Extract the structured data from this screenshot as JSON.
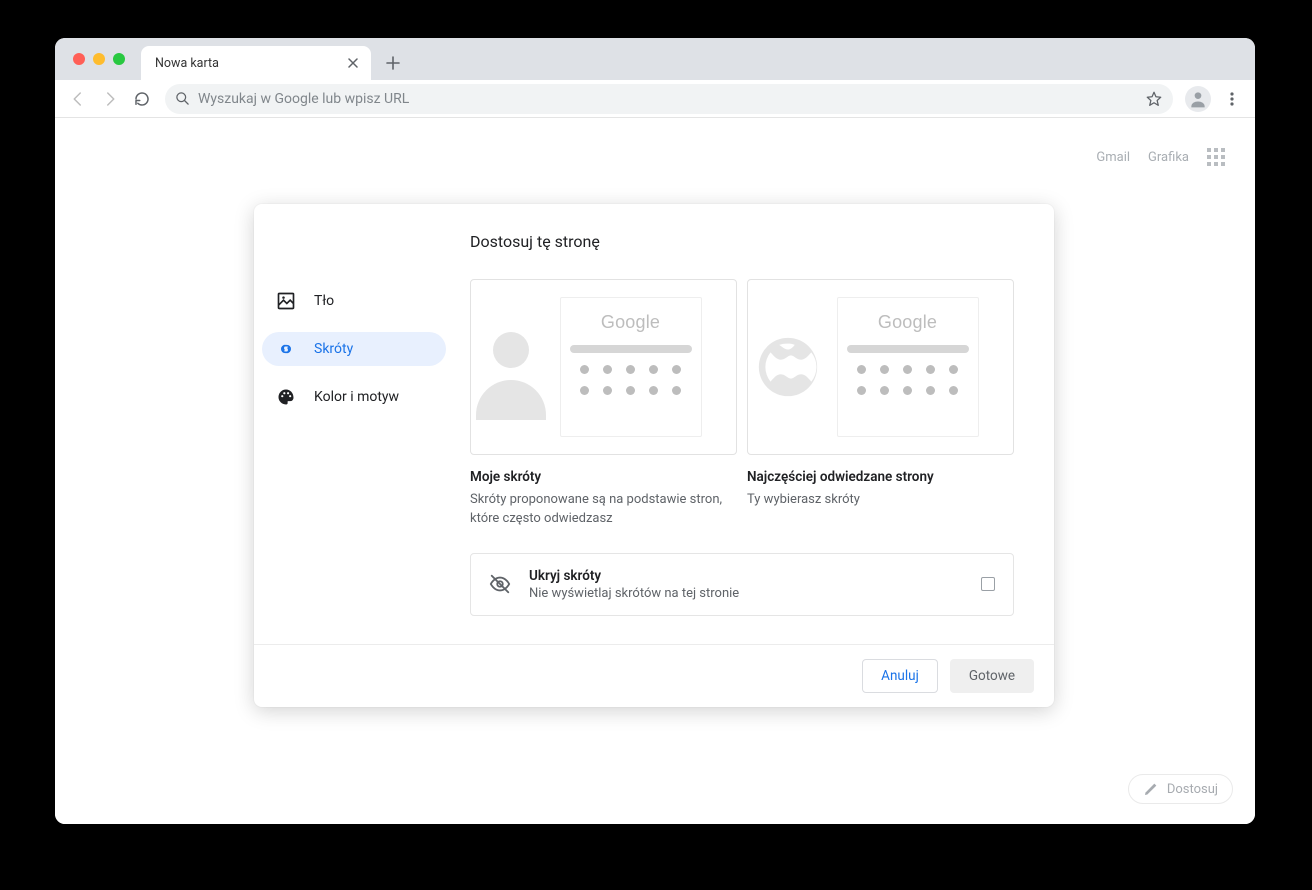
{
  "tab": {
    "title": "Nowa karta"
  },
  "omnibox": {
    "placeholder": "Wyszukaj w Google lub wpisz URL"
  },
  "ntp": {
    "links": {
      "gmail": "Gmail",
      "images": "Grafika"
    },
    "customize_btn": "Dostosuj"
  },
  "dialog": {
    "title": "Dostosuj tę stronę",
    "nav": {
      "background": "Tło",
      "shortcuts": "Skróty",
      "theme": "Kolor i motyw"
    },
    "options": {
      "my_shortcuts": {
        "title": "Moje skróty",
        "desc": "Skróty proponowane są na podstawie stron, które często odwiedzasz",
        "mock_logo": "Google"
      },
      "most_visited": {
        "title": "Najczęściej odwiedzane strony",
        "desc": "Ty wybierasz skróty",
        "mock_logo": "Google"
      }
    },
    "hide": {
      "title": "Ukryj skróty",
      "desc": "Nie wyświetlaj skrótów na tej stronie"
    },
    "footer": {
      "cancel": "Anuluj",
      "done": "Gotowe"
    }
  }
}
